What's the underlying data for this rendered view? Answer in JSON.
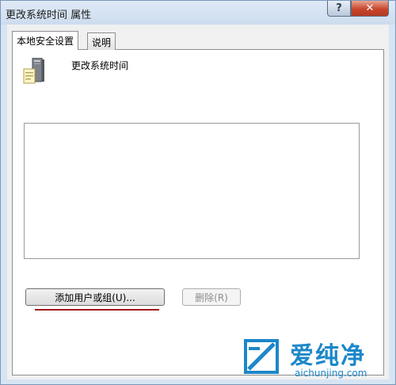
{
  "window": {
    "title": "更改系统时间 属性",
    "help_label": "?",
    "close_label": "✕"
  },
  "tabs": [
    {
      "label": "本地安全设置",
      "active": true
    },
    {
      "label": "说明",
      "active": false
    }
  ],
  "policy": {
    "title": "更改系统时间",
    "icon": "policy-computer-icon"
  },
  "list": {
    "items": []
  },
  "buttons": {
    "add_label": "添加用户或组(U)...",
    "remove_label": "删除(R)"
  },
  "watermark": {
    "text": "爱纯净",
    "url": "aichunjing.com"
  },
  "colors": {
    "title_bar": "#d6e4f3",
    "close_button": "#c8452c",
    "annotation_underline": "#a3191d",
    "watermark": "#1c87c9"
  }
}
